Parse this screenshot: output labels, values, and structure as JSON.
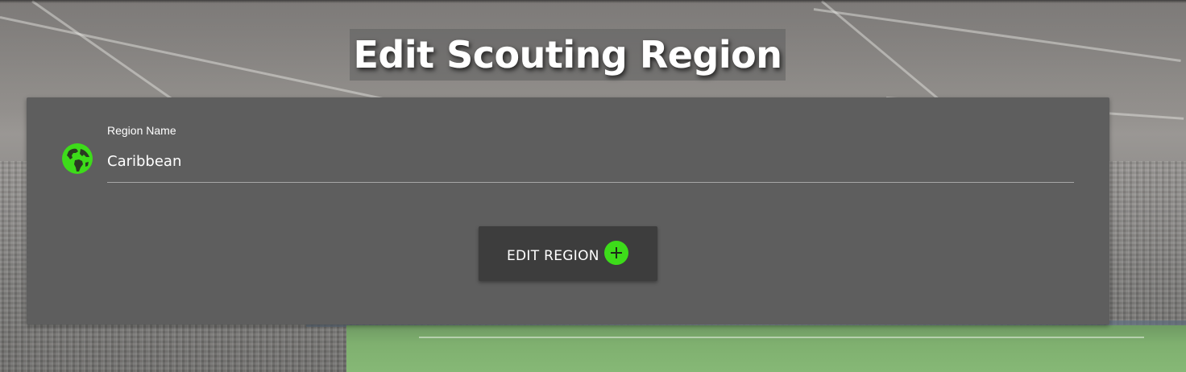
{
  "page": {
    "title": "Edit Scouting Region"
  },
  "form": {
    "region_name_label": "Region Name",
    "region_name_value": "Caribbean",
    "region_icon": "globe-icon"
  },
  "actions": {
    "edit_label": "EDIT REGION",
    "edit_icon": "plus-circle-icon"
  },
  "colors": {
    "accent": "#3ddc1a",
    "card_background": "#5e5e5e",
    "button_background": "#3d3d3d",
    "text": "#ffffff"
  }
}
